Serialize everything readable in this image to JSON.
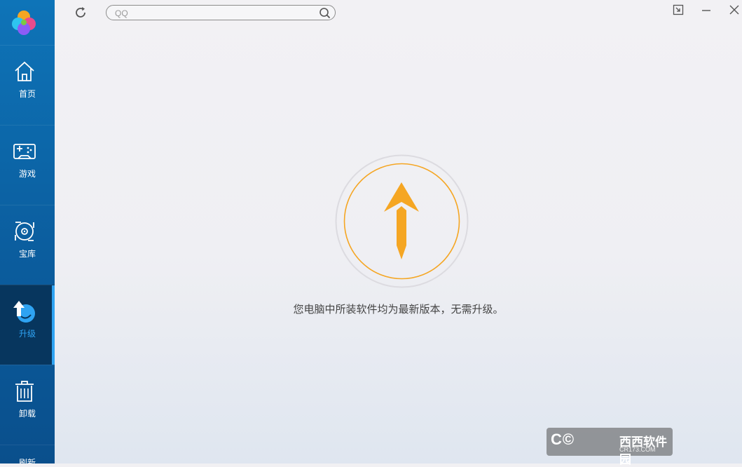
{
  "sidebar": {
    "items": [
      {
        "label": "首页",
        "icon": "home-icon"
      },
      {
        "label": "游戏",
        "icon": "gamepad-icon"
      },
      {
        "label": "宝库",
        "icon": "disc-icon"
      },
      {
        "label": "升级",
        "icon": "upgrade-icon",
        "active": true
      },
      {
        "label": "卸载",
        "icon": "trash-icon"
      }
    ],
    "partial_label": "刷新"
  },
  "search": {
    "value": "QQ"
  },
  "main": {
    "message": "您电脑中所装软件均为最新版本，无需升级。"
  },
  "watermark": {
    "brand": "西西软件园",
    "url": "CR173.COM"
  },
  "colors": {
    "sidebar": "#0b5d9e",
    "active_bg": "#07365e",
    "active_accent": "#2ea3f2",
    "arrow": "#f5a623"
  }
}
